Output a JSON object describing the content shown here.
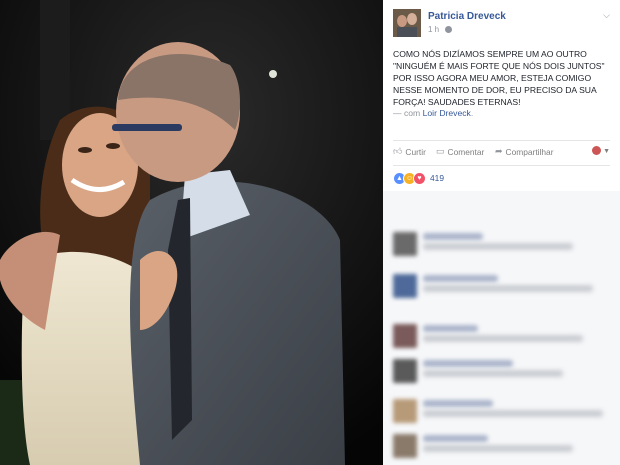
{
  "post": {
    "author": "Patricia Dreveck",
    "time": "1 h",
    "caption": "COMO NÓS DIZÍAMOS SEMPRE UM AO OUTRO \"NINGUÉM É MAIS FORTE QUE NÓS DOIS JUNTOS\" POR ISSO AGORA MEU AMOR, ESTEJA COMIGO NESSE MOMENTO DE DOR, EU PRECISO DA SUA FORÇA! SAUDADES ETERNAS!",
    "with_prefix": "— com",
    "with_name": "Loir Dreveck",
    "with_suffix": "."
  },
  "actions": {
    "like": "Curtir",
    "comment": "Comentar",
    "share": "Compartilhar"
  },
  "reactions": {
    "count": "419",
    "types": [
      "like-icon",
      "haha-icon",
      "love-icon"
    ]
  },
  "colors": {
    "link": "#365899",
    "muted": "#90949c",
    "like_blue": "#5890ff",
    "love_red": "#f25268",
    "haha_yellow": "#f7b125"
  },
  "comments_blurred": true
}
